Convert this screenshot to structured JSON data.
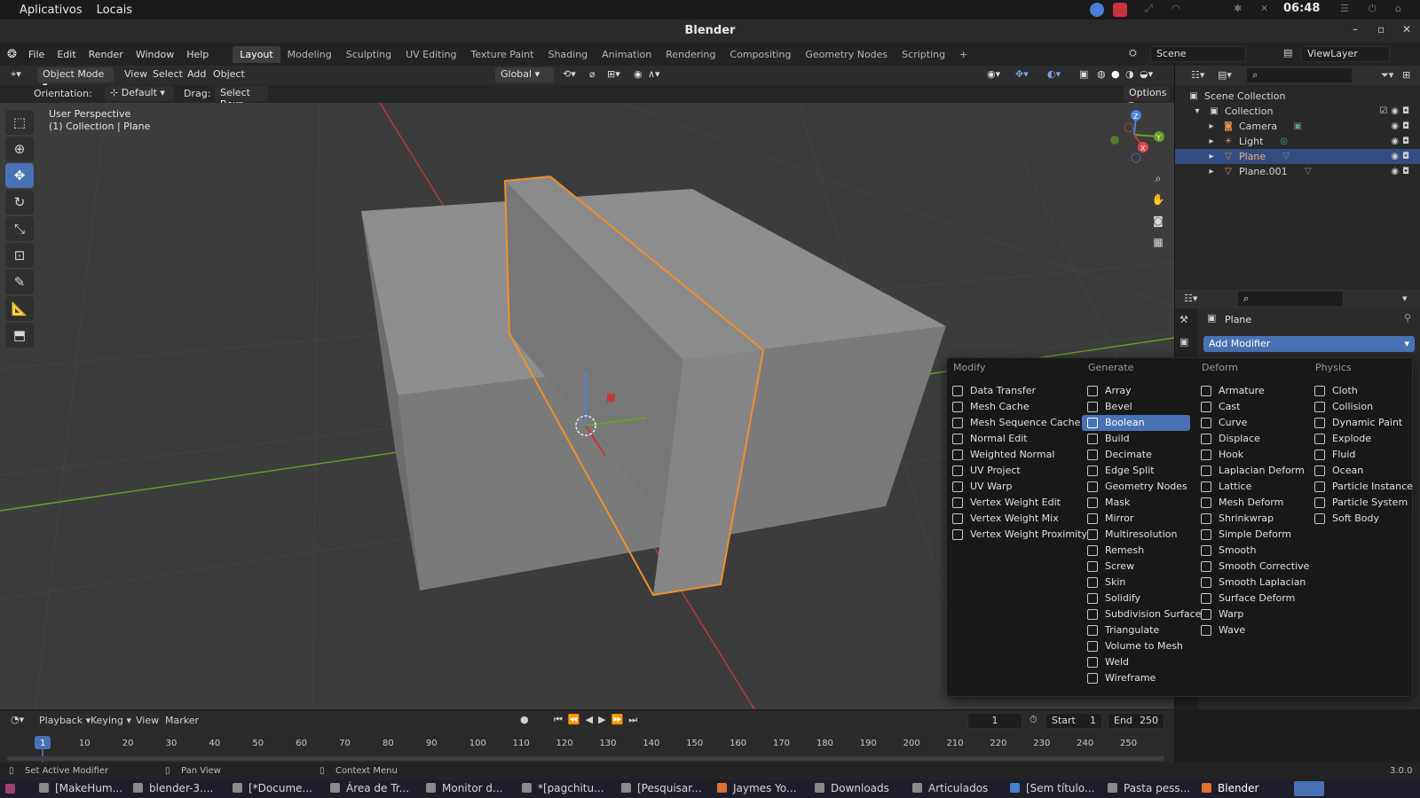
{
  "os": {
    "menus": [
      "Aplicativos",
      "Locais"
    ],
    "clock": "06:48"
  },
  "window": {
    "title": "Blender"
  },
  "blender_menus": [
    "File",
    "Edit",
    "Render",
    "Window",
    "Help"
  ],
  "workspaces": [
    "Layout",
    "Modeling",
    "Sculpting",
    "UV Editing",
    "Texture Paint",
    "Shading",
    "Animation",
    "Rendering",
    "Compositing",
    "Geometry Nodes",
    "Scripting"
  ],
  "active_workspace": "Layout",
  "scene_name": "Scene",
  "view_layer": "ViewLayer",
  "viewport_header": {
    "mode": "Object Mode",
    "menus": [
      "View",
      "Select",
      "Add",
      "Object"
    ],
    "transform_orientation": "Global",
    "options_label": "Options"
  },
  "viewport_tool": {
    "orientation_label": "Orientation:",
    "orientation_value": "Default",
    "drag_label": "Drag:",
    "drag_value": "Select Box"
  },
  "viewport_overlay": {
    "line1": "User Perspective",
    "line2": "(1) Collection | Plane"
  },
  "gizmo": {
    "x": "X",
    "y": "Y",
    "z": "Z"
  },
  "outliner": {
    "scene_collection": "Scene Collection",
    "collection": "Collection",
    "items": [
      "Camera",
      "Light",
      "Plane",
      "Plane.001"
    ],
    "selected": "Plane"
  },
  "properties": {
    "object_name": "Plane",
    "add_modifier": "Add Modifier"
  },
  "modifier_menu": {
    "columns": [
      {
        "header": "Modify",
        "items": [
          "Data Transfer",
          "Mesh Cache",
          "Mesh Sequence Cache",
          "Normal Edit",
          "Weighted Normal",
          "UV Project",
          "UV Warp",
          "Vertex Weight Edit",
          "Vertex Weight Mix",
          "Vertex Weight Proximity"
        ]
      },
      {
        "header": "Generate",
        "items": [
          "Array",
          "Bevel",
          "Boolean",
          "Build",
          "Decimate",
          "Edge Split",
          "Geometry Nodes",
          "Mask",
          "Mirror",
          "Multiresolution",
          "Remesh",
          "Screw",
          "Skin",
          "Solidify",
          "Subdivision Surface",
          "Triangulate",
          "Volume to Mesh",
          "Weld",
          "Wireframe"
        ]
      },
      {
        "header": "Deform",
        "items": [
          "Armature",
          "Cast",
          "Curve",
          "Displace",
          "Hook",
          "Laplacian Deform",
          "Lattice",
          "Mesh Deform",
          "Shrinkwrap",
          "Simple Deform",
          "Smooth",
          "Smooth Corrective",
          "Smooth Laplacian",
          "Surface Deform",
          "Warp",
          "Wave"
        ]
      },
      {
        "header": "Physics",
        "items": [
          "Cloth",
          "Collision",
          "Dynamic Paint",
          "Explode",
          "Fluid",
          "Ocean",
          "Particle Instance",
          "Particle System",
          "Soft Body"
        ]
      }
    ],
    "highlighted": "Boolean"
  },
  "timeline": {
    "menus": [
      "Playback",
      "Keying",
      "View",
      "Marker"
    ],
    "current_frame": "1",
    "start_label": "Start",
    "start": "1",
    "end_label": "End",
    "end": "250",
    "ticks": [
      "1",
      "10",
      "20",
      "30",
      "40",
      "50",
      "60",
      "70",
      "80",
      "90",
      "100",
      "110",
      "120",
      "130",
      "140",
      "150",
      "160",
      "170",
      "180",
      "190",
      "200",
      "210",
      "220",
      "230",
      "240",
      "250"
    ]
  },
  "statusbar": {
    "items": [
      "Set Active Modifier",
      "Pan View",
      "Context Menu"
    ],
    "version": "3.0.0"
  },
  "taskbar": {
    "items": [
      "[MakeHum...",
      "blender-3....",
      "[*Docume...",
      "Área de Tr...",
      "Monitor d...",
      "*[pagchitu...",
      "[Pesquisar...",
      "Jaymes Yo...",
      "Downloads",
      "Articulados",
      "[Sem título...",
      "Pasta pess...",
      "Blender"
    ]
  },
  "colors": {
    "accent": "#4772b3",
    "selection_outline": "#f0902c",
    "viewport_bg": "#3c3c3c",
    "axis_x": "#c03838",
    "axis_y": "#6aa02a"
  }
}
